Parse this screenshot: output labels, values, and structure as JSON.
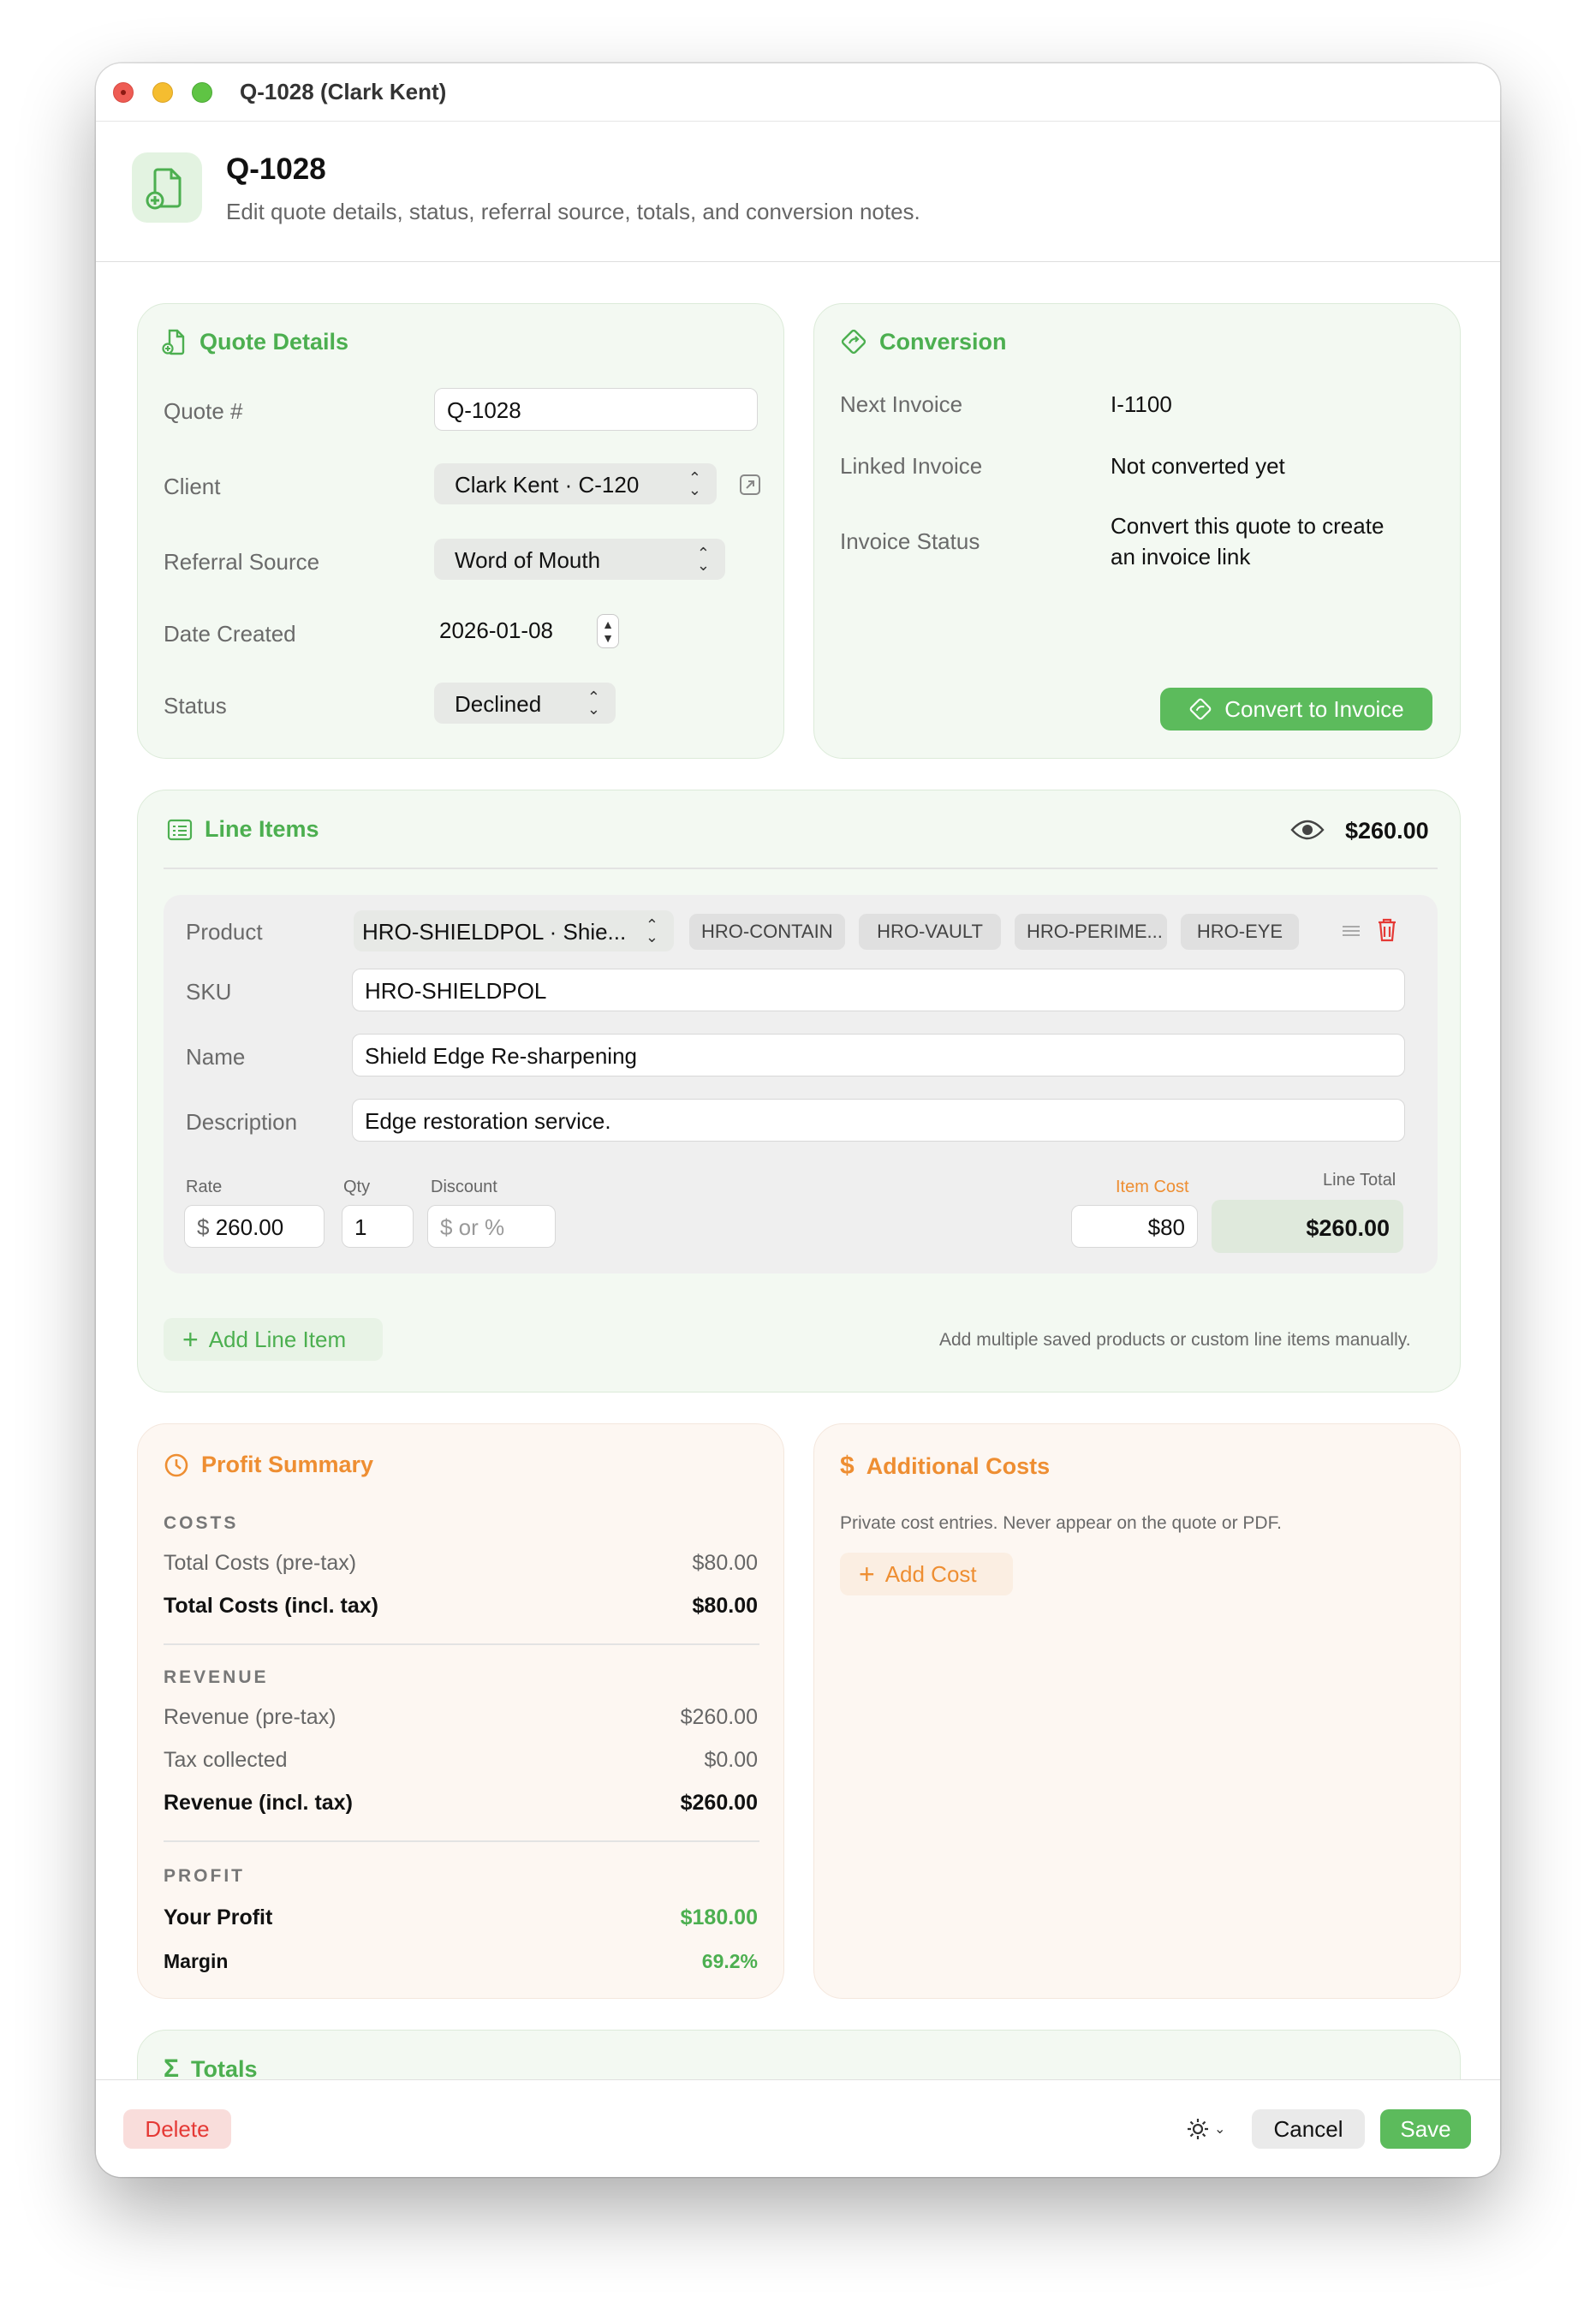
{
  "window": {
    "title": "Q-1028 (Clark Kent)"
  },
  "header": {
    "title": "Q-1028",
    "subtitle": "Edit quote details, status, referral source, totals, and conversion notes."
  },
  "quote_details": {
    "title": "Quote Details",
    "quote_label": "Quote #",
    "quote_value": "Q-1028",
    "client_label": "Client",
    "client_value": "Clark Kent · C-120",
    "referral_label": "Referral Source",
    "referral_value": "Word of Mouth",
    "date_label": "Date Created",
    "date_value": "2026-01-08",
    "status_label": "Status",
    "status_value": "Declined"
  },
  "conversion": {
    "title": "Conversion",
    "next_invoice_label": "Next Invoice",
    "next_invoice_value": "I-1100",
    "linked_label": "Linked Invoice",
    "linked_value": "Not converted yet",
    "status_label": "Invoice Status",
    "status_value_line1": "Convert this quote to create",
    "status_value_line2": "an invoice link",
    "button": "Convert to Invoice"
  },
  "line_items": {
    "title": "Line Items",
    "total": "$260.00",
    "product_label": "Product",
    "product_value": "HRO-SHIELDPOL · Shie...",
    "chips": [
      "HRO-CONTAIN",
      "HRO-VAULT",
      "HRO-PERIME...",
      "HRO-EYE"
    ],
    "sku_label": "SKU",
    "sku_value": "HRO-SHIELDPOL",
    "name_label": "Name",
    "name_value": "Shield Edge Re-sharpening",
    "desc_label": "Description",
    "desc_value": "Edge restoration service.",
    "rate_label": "Rate",
    "rate_prefix": "$",
    "rate_value": "260.00",
    "qty_label": "Qty",
    "qty_value": "1",
    "discount_label": "Discount",
    "discount_placeholder": "$ or %",
    "item_cost_label": "Item Cost",
    "item_cost_value": "$80",
    "line_total_label": "Line Total",
    "line_total_value": "$260.00",
    "add_button": "Add Line Item",
    "hint": "Add multiple saved products or custom line items manually."
  },
  "profit": {
    "title": "Profit Summary",
    "costs_head": "COSTS",
    "total_costs_pre_label": "Total Costs (pre-tax)",
    "total_costs_pre_value": "$80.00",
    "total_costs_incl_label": "Total Costs (incl. tax)",
    "total_costs_incl_value": "$80.00",
    "revenue_head": "REVENUE",
    "revenue_pre_label": "Revenue (pre-tax)",
    "revenue_pre_value": "$260.00",
    "tax_label": "Tax collected",
    "tax_value": "$0.00",
    "revenue_incl_label": "Revenue (incl. tax)",
    "revenue_incl_value": "$260.00",
    "profit_head": "PROFIT",
    "your_profit_label": "Your Profit",
    "your_profit_value": "$180.00",
    "margin_label": "Margin",
    "margin_value": "69.2%"
  },
  "additional_costs": {
    "title": "Additional Costs",
    "note": "Private cost entries. Never appear on the quote or PDF.",
    "add_button": "Add Cost"
  },
  "totals": {
    "title": "Totals"
  },
  "footer": {
    "delete": "Delete",
    "cancel": "Cancel",
    "save": "Save"
  },
  "colors": {
    "green": "#4caf50",
    "orange": "#ee8e32",
    "delete_red": "#e53935"
  },
  "icons": [
    "doc-plus-icon",
    "conversion-tag-icon",
    "list-icon",
    "eye-icon",
    "drag-handle-icon",
    "trash-icon",
    "plus-icon",
    "clock-icon",
    "dollar-icon",
    "sigma-icon",
    "gear-icon"
  ]
}
